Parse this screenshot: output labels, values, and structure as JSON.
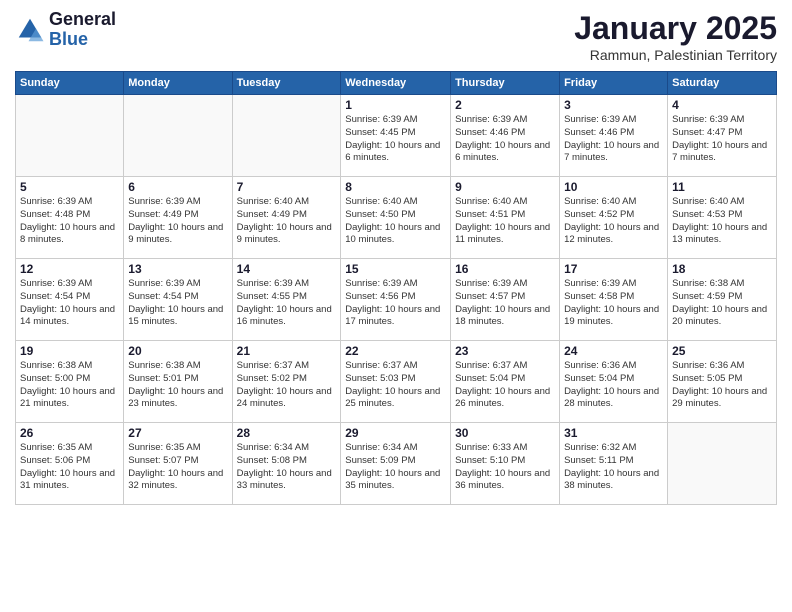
{
  "header": {
    "logo_line1": "General",
    "logo_line2": "Blue",
    "month": "January 2025",
    "location": "Rammun, Palestinian Territory"
  },
  "days_of_week": [
    "Sunday",
    "Monday",
    "Tuesday",
    "Wednesday",
    "Thursday",
    "Friday",
    "Saturday"
  ],
  "weeks": [
    [
      {
        "day": "",
        "info": ""
      },
      {
        "day": "",
        "info": ""
      },
      {
        "day": "",
        "info": ""
      },
      {
        "day": "1",
        "info": "Sunrise: 6:39 AM\nSunset: 4:45 PM\nDaylight: 10 hours and 6 minutes."
      },
      {
        "day": "2",
        "info": "Sunrise: 6:39 AM\nSunset: 4:46 PM\nDaylight: 10 hours and 6 minutes."
      },
      {
        "day": "3",
        "info": "Sunrise: 6:39 AM\nSunset: 4:46 PM\nDaylight: 10 hours and 7 minutes."
      },
      {
        "day": "4",
        "info": "Sunrise: 6:39 AM\nSunset: 4:47 PM\nDaylight: 10 hours and 7 minutes."
      }
    ],
    [
      {
        "day": "5",
        "info": "Sunrise: 6:39 AM\nSunset: 4:48 PM\nDaylight: 10 hours and 8 minutes."
      },
      {
        "day": "6",
        "info": "Sunrise: 6:39 AM\nSunset: 4:49 PM\nDaylight: 10 hours and 9 minutes."
      },
      {
        "day": "7",
        "info": "Sunrise: 6:40 AM\nSunset: 4:49 PM\nDaylight: 10 hours and 9 minutes."
      },
      {
        "day": "8",
        "info": "Sunrise: 6:40 AM\nSunset: 4:50 PM\nDaylight: 10 hours and 10 minutes."
      },
      {
        "day": "9",
        "info": "Sunrise: 6:40 AM\nSunset: 4:51 PM\nDaylight: 10 hours and 11 minutes."
      },
      {
        "day": "10",
        "info": "Sunrise: 6:40 AM\nSunset: 4:52 PM\nDaylight: 10 hours and 12 minutes."
      },
      {
        "day": "11",
        "info": "Sunrise: 6:40 AM\nSunset: 4:53 PM\nDaylight: 10 hours and 13 minutes."
      }
    ],
    [
      {
        "day": "12",
        "info": "Sunrise: 6:39 AM\nSunset: 4:54 PM\nDaylight: 10 hours and 14 minutes."
      },
      {
        "day": "13",
        "info": "Sunrise: 6:39 AM\nSunset: 4:54 PM\nDaylight: 10 hours and 15 minutes."
      },
      {
        "day": "14",
        "info": "Sunrise: 6:39 AM\nSunset: 4:55 PM\nDaylight: 10 hours and 16 minutes."
      },
      {
        "day": "15",
        "info": "Sunrise: 6:39 AM\nSunset: 4:56 PM\nDaylight: 10 hours and 17 minutes."
      },
      {
        "day": "16",
        "info": "Sunrise: 6:39 AM\nSunset: 4:57 PM\nDaylight: 10 hours and 18 minutes."
      },
      {
        "day": "17",
        "info": "Sunrise: 6:39 AM\nSunset: 4:58 PM\nDaylight: 10 hours and 19 minutes."
      },
      {
        "day": "18",
        "info": "Sunrise: 6:38 AM\nSunset: 4:59 PM\nDaylight: 10 hours and 20 minutes."
      }
    ],
    [
      {
        "day": "19",
        "info": "Sunrise: 6:38 AM\nSunset: 5:00 PM\nDaylight: 10 hours and 21 minutes."
      },
      {
        "day": "20",
        "info": "Sunrise: 6:38 AM\nSunset: 5:01 PM\nDaylight: 10 hours and 23 minutes."
      },
      {
        "day": "21",
        "info": "Sunrise: 6:37 AM\nSunset: 5:02 PM\nDaylight: 10 hours and 24 minutes."
      },
      {
        "day": "22",
        "info": "Sunrise: 6:37 AM\nSunset: 5:03 PM\nDaylight: 10 hours and 25 minutes."
      },
      {
        "day": "23",
        "info": "Sunrise: 6:37 AM\nSunset: 5:04 PM\nDaylight: 10 hours and 26 minutes."
      },
      {
        "day": "24",
        "info": "Sunrise: 6:36 AM\nSunset: 5:04 PM\nDaylight: 10 hours and 28 minutes."
      },
      {
        "day": "25",
        "info": "Sunrise: 6:36 AM\nSunset: 5:05 PM\nDaylight: 10 hours and 29 minutes."
      }
    ],
    [
      {
        "day": "26",
        "info": "Sunrise: 6:35 AM\nSunset: 5:06 PM\nDaylight: 10 hours and 31 minutes."
      },
      {
        "day": "27",
        "info": "Sunrise: 6:35 AM\nSunset: 5:07 PM\nDaylight: 10 hours and 32 minutes."
      },
      {
        "day": "28",
        "info": "Sunrise: 6:34 AM\nSunset: 5:08 PM\nDaylight: 10 hours and 33 minutes."
      },
      {
        "day": "29",
        "info": "Sunrise: 6:34 AM\nSunset: 5:09 PM\nDaylight: 10 hours and 35 minutes."
      },
      {
        "day": "30",
        "info": "Sunrise: 6:33 AM\nSunset: 5:10 PM\nDaylight: 10 hours and 36 minutes."
      },
      {
        "day": "31",
        "info": "Sunrise: 6:32 AM\nSunset: 5:11 PM\nDaylight: 10 hours and 38 minutes."
      },
      {
        "day": "",
        "info": ""
      }
    ]
  ]
}
